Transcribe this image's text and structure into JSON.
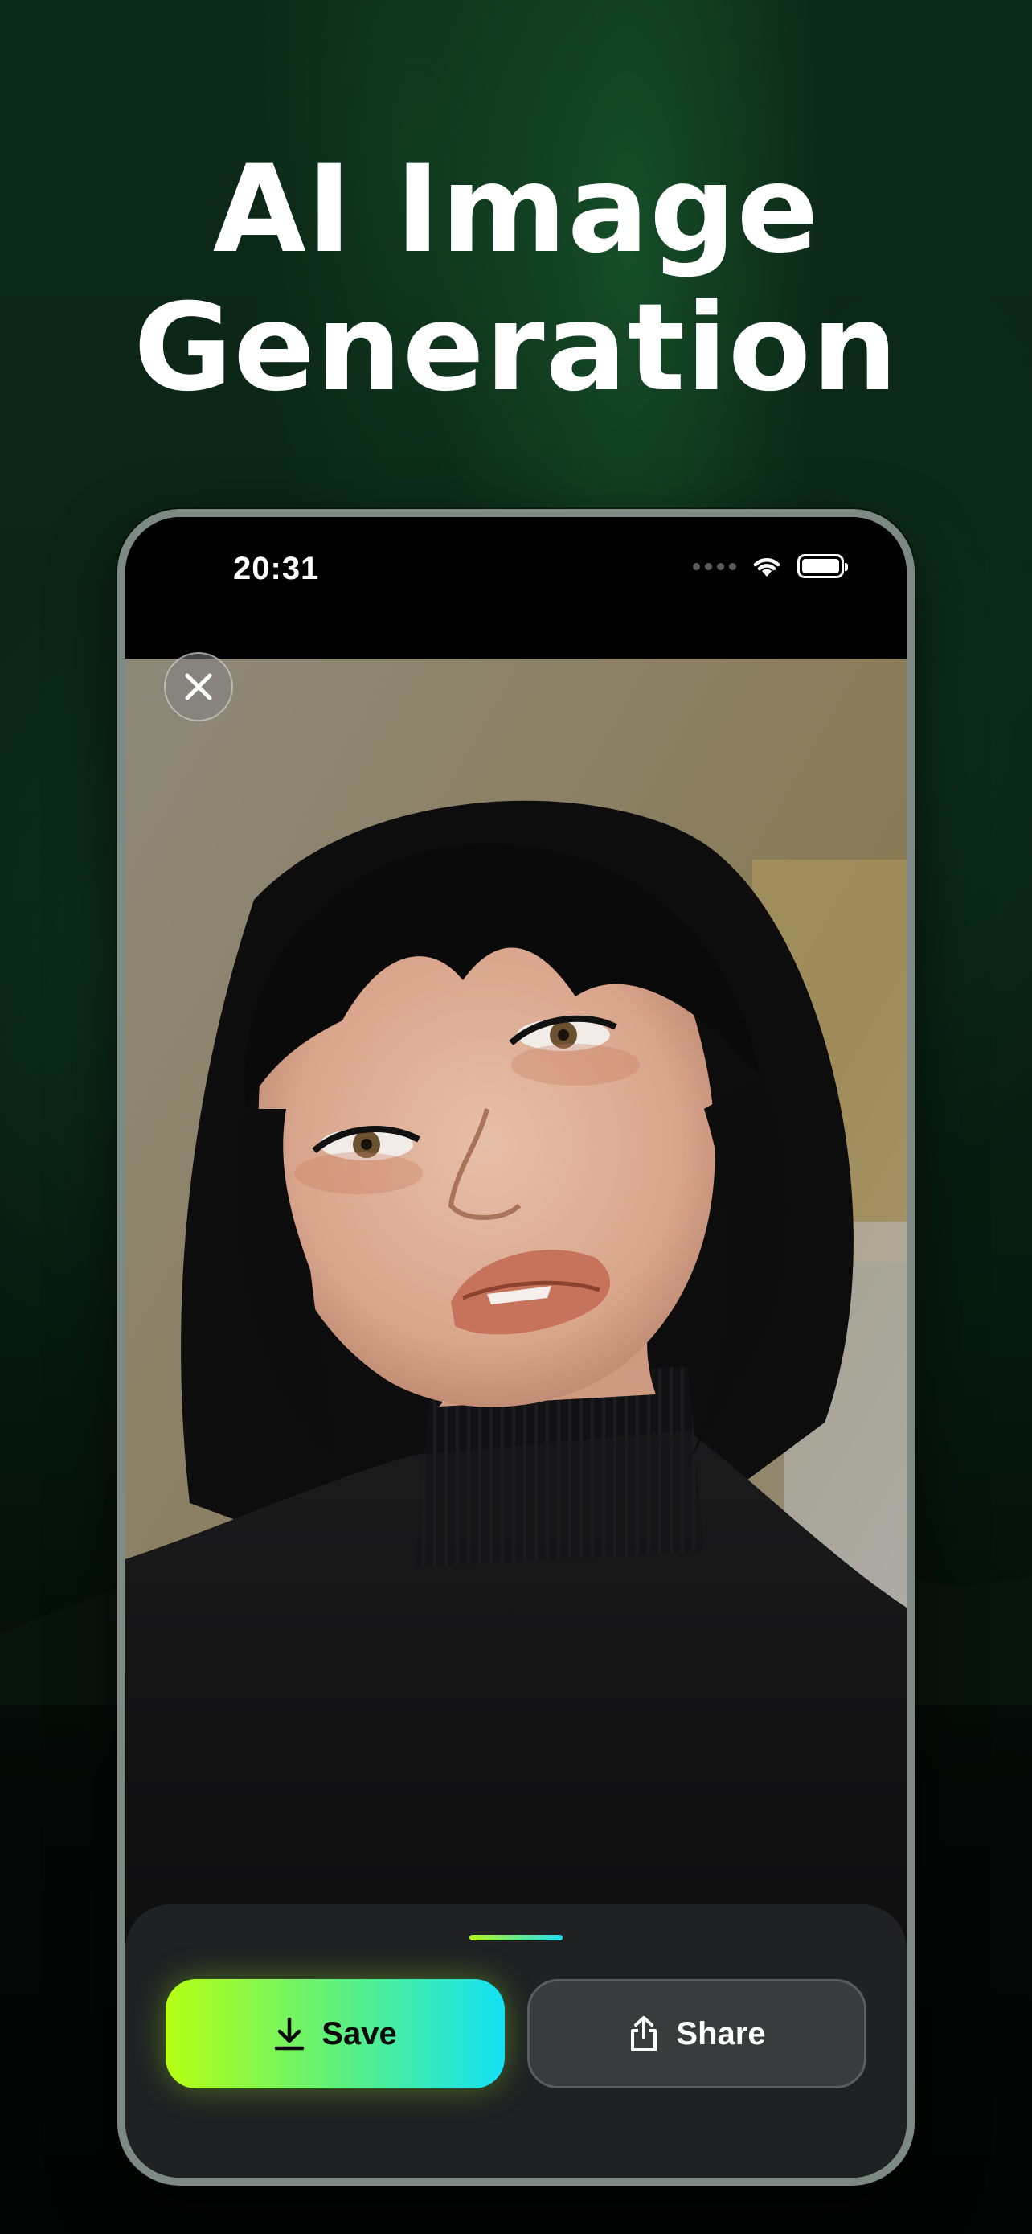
{
  "headline": {
    "line1": "AI Image",
    "line2": "Generation"
  },
  "status_bar": {
    "time": "20:31",
    "wifi_icon": "wifi-icon",
    "battery_icon": "battery-icon"
  },
  "viewer": {
    "close_icon": "close-icon",
    "image_subject": "portrait-photo"
  },
  "actions": {
    "save_label": "Save",
    "save_icon": "download-icon",
    "share_label": "Share",
    "share_icon": "share-icon"
  },
  "colors": {
    "accent_start": "#b6ff12",
    "accent_end": "#12e1f5",
    "sheet_bg": "#1f2123"
  }
}
